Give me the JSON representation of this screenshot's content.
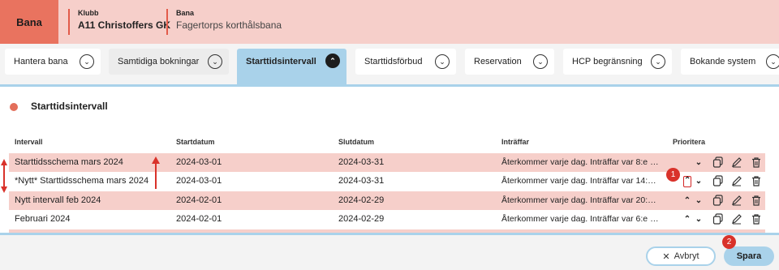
{
  "header": {
    "badge": "Bana",
    "club_label": "Klubb",
    "club_value": "A11 Christoffers GK",
    "course_label": "Bana",
    "course_value": "Fagertorps korthålsbana"
  },
  "tabs": [
    {
      "label": "Hantera bana"
    },
    {
      "label": "Samtidiga bokningar"
    },
    {
      "label": "Starttidsintervall"
    },
    {
      "label": "Starttidsförbud"
    },
    {
      "label": "Reservation"
    },
    {
      "label": "HCP begränsning"
    },
    {
      "label": "Bokande system"
    }
  ],
  "section": {
    "title": "Starttidsintervall"
  },
  "table": {
    "headers": [
      "Intervall",
      "Startdatum",
      "Slutdatum",
      "Inträffar",
      "Prioritera"
    ],
    "rows": [
      {
        "interval": "Starttidsschema mars 2024",
        "start": "2024-03-01",
        "end": "2024-03-31",
        "occurs": "Återkommer varje dag. Inträffar var 8:e m..."
      },
      {
        "interval": "*Nytt* Starttidsschema mars 2024",
        "start": "2024-03-01",
        "end": "2024-03-31",
        "occurs": "Återkommer varje dag. Inträffar var 14:e ..."
      },
      {
        "interval": "Nytt intervall feb 2024",
        "start": "2024-02-01",
        "end": "2024-02-29",
        "occurs": "Återkommer varje dag. Inträffar var 20:e ..."
      },
      {
        "interval": "Februari 2024",
        "start": "2024-02-01",
        "end": "2024-02-29",
        "occurs": "Återkommer varje dag. Inträffar var 6:e m..."
      }
    ]
  },
  "footer": {
    "cancel_label": "Avbryt",
    "save_label": "Spara"
  },
  "annotations": {
    "marker1": "1",
    "marker2": "2",
    "color": "#d9322a"
  },
  "colors": {
    "accent": "#e9735f",
    "row_highlight": "#f6cfca",
    "active_tab": "#a9d2ea"
  }
}
